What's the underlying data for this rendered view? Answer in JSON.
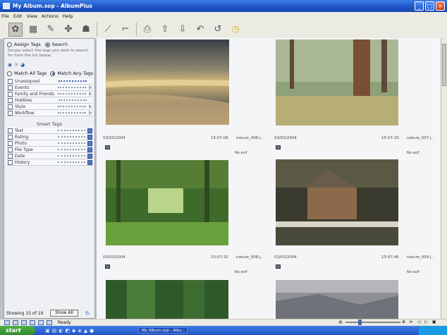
{
  "window": {
    "title": "My Album.sop - AlbumPlus"
  },
  "menu": [
    "File",
    "Edit",
    "View",
    "Actions",
    "Help"
  ],
  "panel": {
    "mode_assign": "Assign Tags",
    "mode_search": "Search",
    "instructions": "Simply select the tags you wish to search for from the list below.",
    "match_all": "Match All Tags",
    "match_any": "Match Any Tags",
    "tags": [
      "Unassigned",
      "Events",
      "Family and Friends",
      "Hobbies",
      "Style",
      "Workflow"
    ],
    "smart_tags_header": "Smart Tags",
    "smart_tags": [
      "Text",
      "Rating",
      "Photo",
      "File Type",
      "Date",
      "History"
    ],
    "showing": "Showing 15 of 19",
    "show_all": "Show All"
  },
  "gallery": {
    "items": [
      {
        "date": "03/03/2004",
        "time": "15:07:06",
        "file": "nature_006.j..",
        "exif": "No exif"
      },
      {
        "date": "03/03/2004",
        "time": "15:07:20",
        "file": "nature_007.j..",
        "exif": "No exif"
      },
      {
        "date": "03/03/2004",
        "time": "15:07:32",
        "file": "nature_008.j..",
        "exif": "No exif"
      },
      {
        "date": "03/03/2004",
        "time": "15:07:46",
        "file": "nature_009.j..",
        "exif": "No exif"
      }
    ]
  },
  "status": {
    "text": "Ready"
  },
  "taskbar": {
    "start": "start",
    "item": "My Album.sop - Albu..."
  },
  "colors": {
    "title_blue": "#1f56c8",
    "chrome": "#ecebe3",
    "accent": "#3760b8"
  }
}
